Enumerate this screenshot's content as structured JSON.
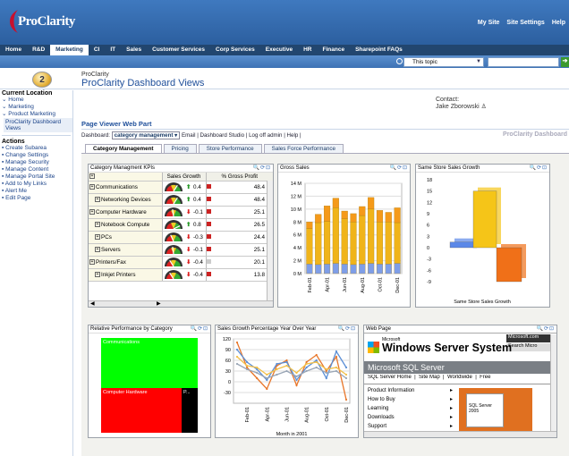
{
  "header": {
    "logo_text": "ProClarity",
    "top_links": [
      "My Site",
      "Site Settings",
      "Help"
    ]
  },
  "tabs": [
    "Home",
    "R&D",
    "Marketing",
    "CI",
    "IT",
    "Sales",
    "Customer Services",
    "Corp Services",
    "Executive",
    "HR",
    "Finance",
    "Sharepoint FAQs"
  ],
  "selected_tab": "Marketing",
  "search": {
    "scope": "This topic",
    "query": ""
  },
  "site": {
    "small_title": "ProClarity",
    "title": "ProClarity Dashboard Views"
  },
  "sidebar": {
    "current_location": "Current Location",
    "locations": [
      "Home",
      "Marketing",
      "Product Marketing"
    ],
    "selected": "ProClarity Dashboard Views",
    "actions_title": "Actions",
    "actions": [
      "Create Subarea",
      "Change Settings",
      "Manage Security",
      "Manage Content",
      "Manage Portal Site",
      "Add to My Links",
      "Alert Me",
      "Edit Page"
    ]
  },
  "contact": {
    "label": "Contact:",
    "name": "Jake Zborowski"
  },
  "page_viewer": {
    "title": "Page Viewer Web Part",
    "dashboard_label": "Dashboard:",
    "dashboard_value": "category management",
    "links": [
      "Email",
      "Dashboard Studio",
      "Log off admin",
      "Help"
    ],
    "brand_right": "ProClarity Dashboard"
  },
  "view_tabs": [
    "Category Management",
    "Pricing",
    "Store Performance",
    "Sales Force Performance"
  ],
  "kpi_panel": {
    "title": "Category Managment KPIs",
    "columns": [
      "Sales Growth",
      "% Gross Profit"
    ],
    "rows": [
      {
        "name": "Communications",
        "indent": 0,
        "dir": "up",
        "growth": "0.4",
        "flag": "red",
        "gp": "48.4"
      },
      {
        "name": "Networking Devices",
        "indent": 1,
        "dir": "up",
        "growth": "0.4",
        "flag": "red",
        "gp": "48.4"
      },
      {
        "name": "Computer Hardware",
        "indent": 0,
        "dir": "down",
        "growth": "-0.1",
        "flag": "red",
        "gp": "25.1"
      },
      {
        "name": "Notebook Compute",
        "indent": 1,
        "dir": "up",
        "growth": "0.8",
        "flag": "red",
        "gp": "26.5"
      },
      {
        "name": "PCs",
        "indent": 1,
        "dir": "down",
        "growth": "-0.3",
        "flag": "red",
        "gp": "24.4"
      },
      {
        "name": "Servers",
        "indent": 1,
        "dir": "down",
        "growth": "-0.1",
        "flag": "red",
        "gp": "25.1"
      },
      {
        "name": "Printers/Fax",
        "indent": 0,
        "dir": "down",
        "growth": "-0.4",
        "flag": "grey",
        "gp": "20.1"
      },
      {
        "name": "Inkjet Printers",
        "indent": 1,
        "dir": "down",
        "growth": "-0.4",
        "flag": "red",
        "gp": "13.8"
      }
    ]
  },
  "gross_sales_panel": {
    "title": "Gross Sales"
  },
  "same_store_panel": {
    "title": "Same Store Sales Growth"
  },
  "relperf_panel": {
    "title": "Relative Performance by Category",
    "blocks": [
      {
        "label": "Communications",
        "color": "#00ff00"
      },
      {
        "label": "Computer Hardware",
        "color": "#ff0000"
      },
      {
        "label": "P...",
        "color": "#000000"
      }
    ]
  },
  "yoy_panel": {
    "title": "Sales Growth Percentage Year Over Year"
  },
  "web_panel": {
    "title": "Web Page",
    "ms_text": "Microsoft.com",
    "search_text": "Search Micro",
    "brand_small": "Microsoft",
    "brand": "Windows Server System",
    "product_bar": "Microsoft SQL Server",
    "nav": [
      "SQL Server Home",
      "Site Map",
      "Worldwide",
      "Free"
    ],
    "menu": [
      "Product Information",
      "How to Buy",
      "Learning",
      "Downloads",
      "Support"
    ],
    "box_text": "SQL Server 2005"
  },
  "chart_data": [
    {
      "type": "bar",
      "title": "Gross Sales",
      "stacked": true,
      "categories": [
        "Feb-01",
        "Mar-01",
        "Apr-01",
        "May-01",
        "Jun-01",
        "Jul-01",
        "Aug-01",
        "Sep-01",
        "Oct-01",
        "Nov-01",
        "Dec-01"
      ],
      "x_tick_labels": [
        "Feb-01",
        "Apr-01",
        "Jun-01",
        "Aug-01",
        "Oct-01",
        "Dec-01"
      ],
      "series": [
        {
          "color": "#7e9ee8",
          "values": [
            1.5,
            1.4,
            1.5,
            1.6,
            1.5,
            1.4,
            1.5,
            1.6,
            1.5,
            1.5,
            1.6
          ]
        },
        {
          "color": "#f0b41a",
          "values": [
            5.5,
            6.5,
            6.6,
            8.6,
            7.0,
            6.6,
            7.5,
            8.4,
            6.5,
            6.5,
            6.3
          ]
        },
        {
          "color": "#f59a1a",
          "values": [
            1.0,
            1.3,
            2.4,
            1.5,
            1.2,
            1.3,
            1.4,
            1.8,
            1.8,
            1.5,
            2.3
          ]
        }
      ],
      "y_ticks": [
        "0 M",
        "2 M",
        "4 M",
        "6 M",
        "8 M",
        "10 M",
        "12 M",
        "14 M"
      ],
      "ylim": [
        0,
        14
      ],
      "grid": true
    },
    {
      "type": "bar",
      "title": "Same Store Sales Growth",
      "xlabel": "Same Store Sales Growth",
      "series": [
        {
          "color": "#5b88e8",
          "values": [
            1.5
          ]
        },
        {
          "color": "#f5c518",
          "values": [
            15
          ]
        },
        {
          "color": "#f07018",
          "values": [
            -9
          ]
        }
      ],
      "y_ticks": [
        "-9",
        "-6",
        "-3",
        "0",
        "3",
        "6",
        "9",
        "12",
        "15",
        "18"
      ],
      "ylim": [
        -9,
        18
      ]
    },
    {
      "type": "line",
      "title": "Sales Growth Percentage Year Over Year",
      "xlabel": "Month in 2001",
      "categories": [
        "Jan-01",
        "Feb-01",
        "Mar-01",
        "Apr-01",
        "May-01",
        "Jun-01",
        "Jul-01",
        "Aug-01",
        "Sep-01",
        "Oct-01",
        "Nov-01",
        "Dec-01"
      ],
      "x_tick_labels": [
        "Feb-01",
        "Apr-01",
        "Jun-01",
        "Aug-01",
        "Oct-01",
        "Dec-01"
      ],
      "series": [
        {
          "color": "#e8762a",
          "values": [
            110,
            40,
            10,
            -20,
            45,
            60,
            -10,
            55,
            75,
            30,
            70,
            -50
          ]
        },
        {
          "color": "#5b8fd6",
          "values": [
            90,
            55,
            35,
            5,
            50,
            55,
            5,
            40,
            60,
            10,
            85,
            40
          ]
        },
        {
          "color": "#f2c04a",
          "values": [
            70,
            45,
            40,
            20,
            35,
            45,
            25,
            50,
            55,
            35,
            40,
            20
          ]
        },
        {
          "color": "#9aa6b6",
          "values": [
            50,
            35,
            25,
            10,
            20,
            30,
            15,
            30,
            40,
            25,
            30,
            10
          ]
        }
      ],
      "y_ticks": [
        "-30",
        "0",
        "30",
        "60",
        "90",
        "120"
      ],
      "ylim": [
        -60,
        120
      ],
      "grid": true
    }
  ]
}
